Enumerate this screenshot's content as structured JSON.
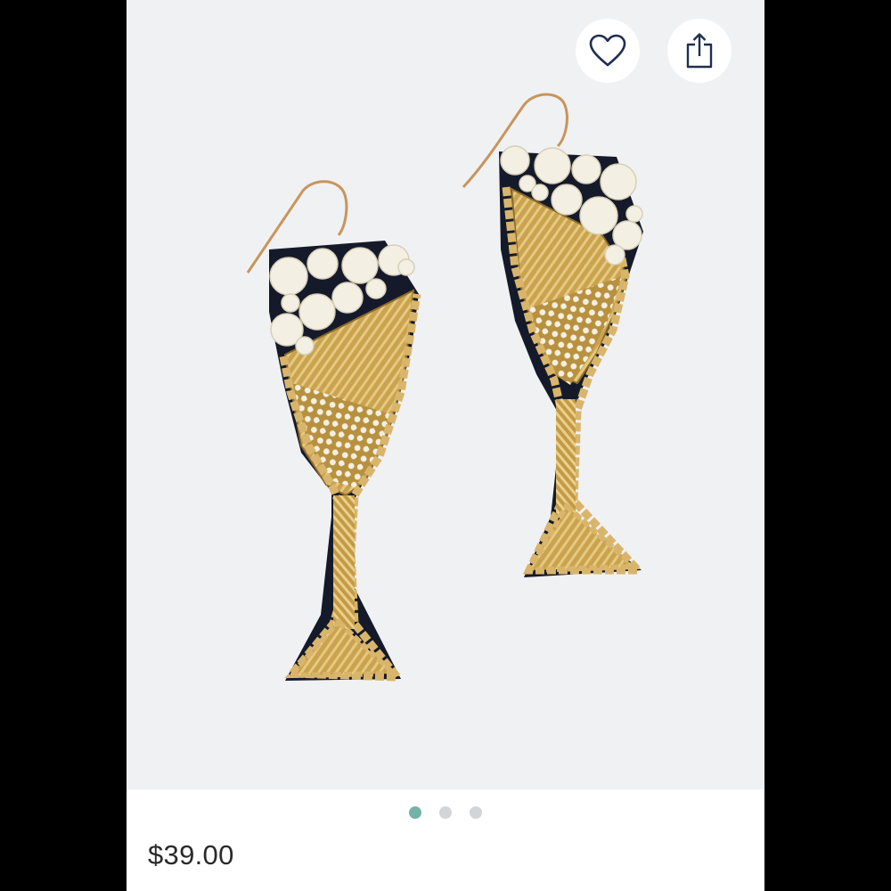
{
  "product": {
    "price": "$39.00"
  },
  "actions": {
    "favorite_icon": "heart-outline-icon",
    "share_icon": "share-icon"
  },
  "carousel": {
    "dots": [
      "active",
      "inactive",
      "inactive"
    ],
    "active_index": 0
  },
  "colors": {
    "image_background": "#f0f1f3",
    "active_dot": "#74b3a8",
    "inactive_dot": "#d3d4d6",
    "icon_color": "#1f2f4f",
    "gold": "#c9a34f",
    "pearl": "#f3efe2"
  }
}
